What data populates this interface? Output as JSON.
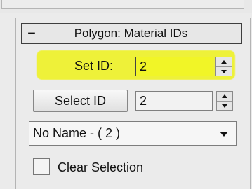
{
  "rollout": {
    "collapse_symbol": "−",
    "title": "Polygon: Material IDs"
  },
  "set_id": {
    "label": "Set ID:",
    "value": "2",
    "highlight_color": "#eff22a"
  },
  "select_id": {
    "button_label": "Select ID",
    "value": "2"
  },
  "material_dropdown": {
    "selected": "No Name - ( 2 )"
  },
  "clear_selection": {
    "label": "Clear Selection",
    "checked": false
  }
}
